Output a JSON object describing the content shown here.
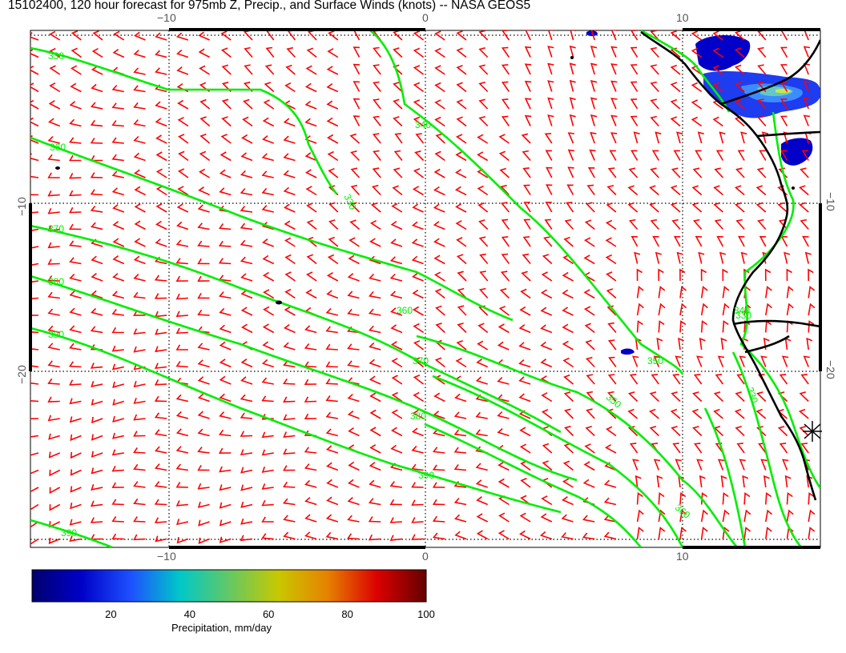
{
  "title": "15102400, 120 hour forecast for 975mb Z, Precip., and Surface Winds (knots) -- NASA GEOS5",
  "axes": {
    "lon_ticks": [
      "−10",
      "0",
      "10"
    ],
    "lat_ticks": [
      "−10",
      "−20"
    ]
  },
  "contours": {
    "color": "#00ee00",
    "levels": [
      "330",
      "340",
      "350",
      "360",
      "370",
      "380",
      "390"
    ],
    "labels_shown": [
      "330",
      "360",
      "370",
      "380",
      "390",
      "330",
      "340",
      "350",
      "360",
      "370",
      "380",
      "390",
      "340",
      "350",
      "330",
      "360",
      "330",
      "390"
    ]
  },
  "wind_barbs": {
    "color": "#ff0000",
    "units": "knots"
  },
  "colorbar": {
    "label": "Precipitation, mm/day",
    "ticks": [
      "20",
      "40",
      "60",
      "80",
      "100"
    ],
    "min": 0,
    "max": 100,
    "colors": [
      "#00006e",
      "#0000c8",
      "#1e50ff",
      "#00c8c8",
      "#64c864",
      "#c8c800",
      "#e68200",
      "#dc0000",
      "#640000"
    ]
  }
}
